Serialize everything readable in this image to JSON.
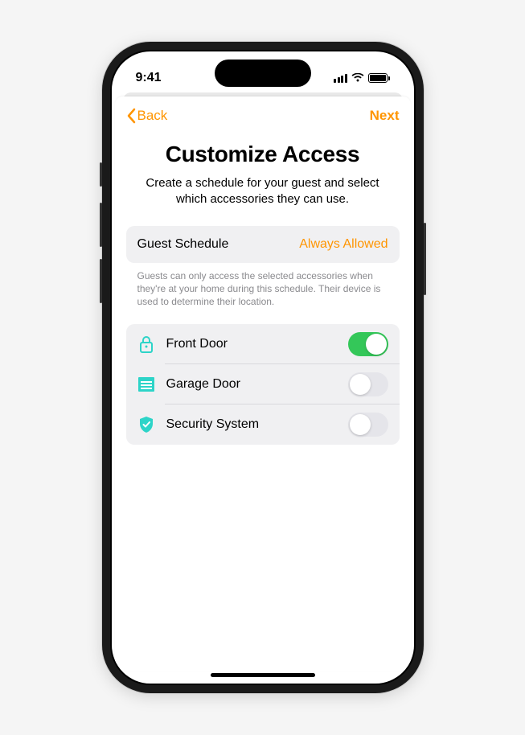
{
  "status": {
    "time": "9:41"
  },
  "nav": {
    "back": "Back",
    "next": "Next"
  },
  "header": {
    "title": "Customize Access",
    "subtitle": "Create a schedule for your guest and select which accessories they can use."
  },
  "schedule": {
    "label": "Guest Schedule",
    "value": "Always Allowed",
    "footer": "Guests can only access the selected accessories when they're at your home during this schedule. Their device is used to determine their location."
  },
  "accessories": [
    {
      "name": "Front Door",
      "icon": "lock",
      "enabled": true
    },
    {
      "name": "Garage Door",
      "icon": "garage",
      "enabled": false
    },
    {
      "name": "Security System",
      "icon": "shield",
      "enabled": false
    }
  ],
  "colors": {
    "accent": "#ff9500",
    "teal": "#2dd4c8",
    "toggle_on": "#34c759"
  }
}
